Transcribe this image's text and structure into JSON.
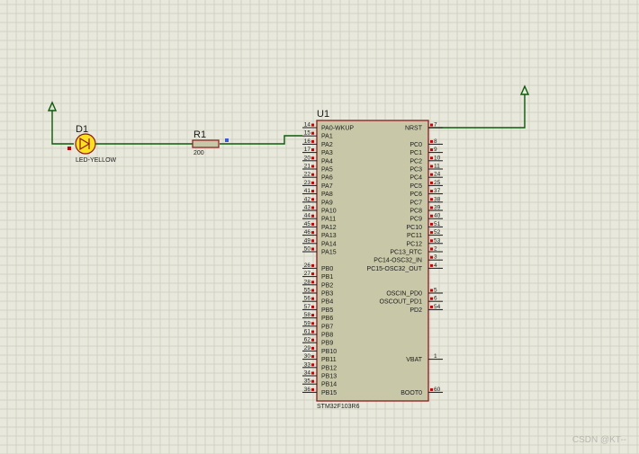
{
  "schematic": {
    "d1_ref": "D1",
    "d1_value": "LED-YELLOW",
    "r1_ref": "R1",
    "r1_value": "200",
    "u1_ref": "U1",
    "u1_part": "STM32F103R6"
  },
  "left_pins": [
    {
      "num": "14",
      "name": "PA0-WKUP"
    },
    {
      "num": "15",
      "name": "PA1"
    },
    {
      "num": "16",
      "name": "PA2"
    },
    {
      "num": "17",
      "name": "PA3"
    },
    {
      "num": "20",
      "name": "PA4"
    },
    {
      "num": "21",
      "name": "PA5"
    },
    {
      "num": "22",
      "name": "PA6"
    },
    {
      "num": "23",
      "name": "PA7"
    },
    {
      "num": "41",
      "name": "PA8"
    },
    {
      "num": "42",
      "name": "PA9"
    },
    {
      "num": "43",
      "name": "PA10"
    },
    {
      "num": "44",
      "name": "PA11"
    },
    {
      "num": "45",
      "name": "PA12"
    },
    {
      "num": "46",
      "name": "PA13"
    },
    {
      "num": "49",
      "name": "PA14"
    },
    {
      "num": "50",
      "name": "PA15"
    },
    {
      "num": "26",
      "name": "PB0"
    },
    {
      "num": "27",
      "name": "PB1"
    },
    {
      "num": "28",
      "name": "PB2"
    },
    {
      "num": "55",
      "name": "PB3"
    },
    {
      "num": "56",
      "name": "PB4"
    },
    {
      "num": "57",
      "name": "PB5"
    },
    {
      "num": "58",
      "name": "PB6"
    },
    {
      "num": "59",
      "name": "PB7"
    },
    {
      "num": "61",
      "name": "PB8"
    },
    {
      "num": "62",
      "name": "PB9"
    },
    {
      "num": "29",
      "name": "PB10"
    },
    {
      "num": "30",
      "name": "PB11"
    },
    {
      "num": "33",
      "name": "PB12"
    },
    {
      "num": "34",
      "name": "PB13"
    },
    {
      "num": "35",
      "name": "PB14"
    },
    {
      "num": "36",
      "name": "PB15"
    }
  ],
  "right_pins": [
    {
      "num": "7",
      "name": "NRST"
    },
    {
      "num": "8",
      "name": "PC0"
    },
    {
      "num": "9",
      "name": "PC1"
    },
    {
      "num": "10",
      "name": "PC2"
    },
    {
      "num": "11",
      "name": "PC3"
    },
    {
      "num": "24",
      "name": "PC4"
    },
    {
      "num": "25",
      "name": "PC5"
    },
    {
      "num": "37",
      "name": "PC6"
    },
    {
      "num": "38",
      "name": "PC7"
    },
    {
      "num": "39",
      "name": "PC8"
    },
    {
      "num": "40",
      "name": "PC9"
    },
    {
      "num": "51",
      "name": "PC10"
    },
    {
      "num": "52",
      "name": "PC11"
    },
    {
      "num": "53",
      "name": "PC12"
    },
    {
      "num": "2",
      "name": "PC13_RTC"
    },
    {
      "num": "3",
      "name": "PC14-OSC32_IN"
    },
    {
      "num": "4",
      "name": "PC15-OSC32_OUT"
    },
    {
      "num": "5",
      "name": "OSCIN_PD0"
    },
    {
      "num": "6",
      "name": "OSCOUT_PD1"
    },
    {
      "num": "54",
      "name": "PD2"
    },
    {
      "num": "1",
      "name": "VBAT"
    },
    {
      "num": "60",
      "name": "BOOT0"
    }
  ],
  "watermark": "CSDN @KT--",
  "colors": {
    "background": "#e8e8dc",
    "grid": "#d4d4c6",
    "chip_fill": "#c8c8a8",
    "chip_border": "#8b1a1a",
    "wire": "#0a5a0a",
    "pin_mark": "#cc0000",
    "led_fill": "#ffe020"
  }
}
